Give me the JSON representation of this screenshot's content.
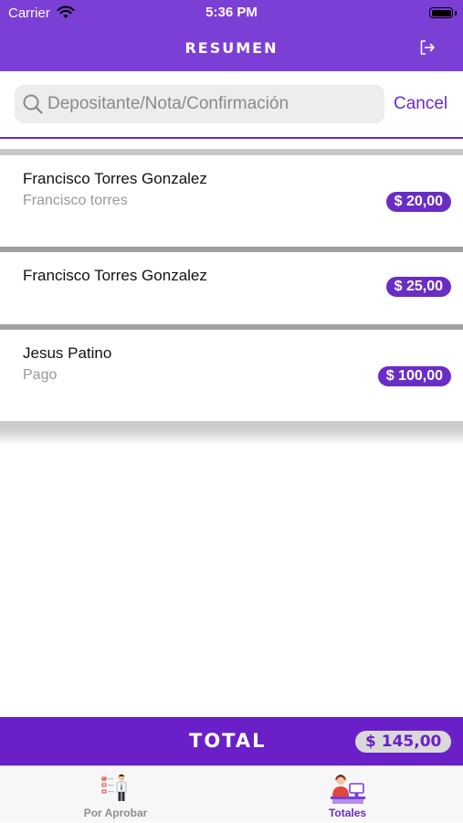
{
  "status_bar": {
    "carrier": "Carrier",
    "time": "5:36 PM"
  },
  "nav": {
    "title": "RESUMEN",
    "logout_icon": "logout-icon",
    "color": "#7b3fd6"
  },
  "search": {
    "placeholder": "Depositante/Nota/Confirmación",
    "value": "",
    "cancel_label": "Cancel"
  },
  "deposits": [
    {
      "depositor": "Francisco Torres Gonzalez",
      "note": "Francisco torres",
      "amount": "$ 20,00"
    },
    {
      "depositor": "Francisco Torres Gonzalez",
      "note": "",
      "amount": "$ 25,00"
    },
    {
      "depositor": "Jesus Patino",
      "note": "Pago",
      "amount": "$ 100,00"
    }
  ],
  "total": {
    "label": "TOTAL",
    "amount": "$ 145,00"
  },
  "tabs": [
    {
      "label": "Por Aprobar",
      "icon": "approver-checklist-icon",
      "selected": false
    },
    {
      "label": "Totales",
      "icon": "cashier-totals-icon",
      "selected": true
    }
  ],
  "colors": {
    "accent": "#6a2dc4",
    "total_bar": "#6a1fc8",
    "tab_inactive": "#8e8e93"
  }
}
